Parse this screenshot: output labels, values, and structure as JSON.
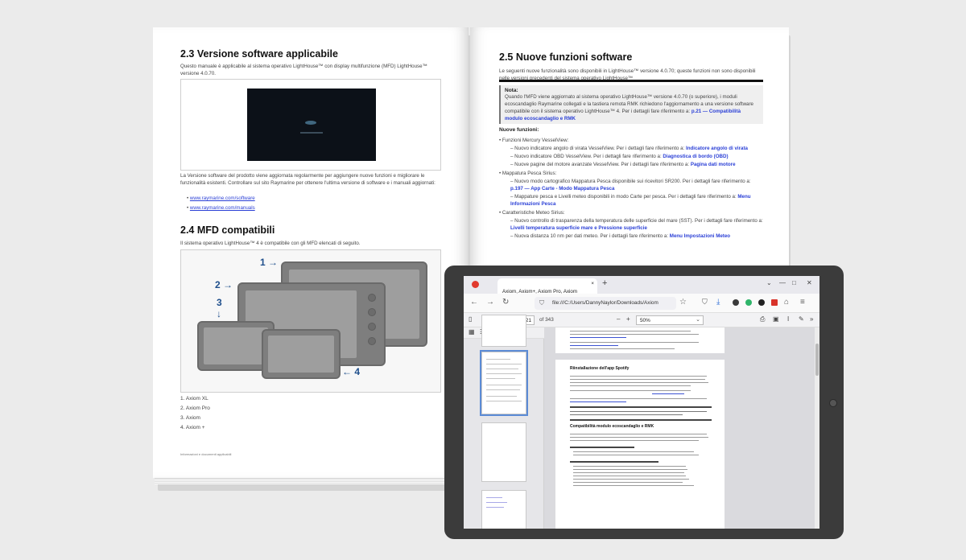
{
  "manual": {
    "left_page": {
      "section_23_title": "2.3 Versione software applicabile",
      "section_23_intro": "Questo manuale è applicabile al sistema operativo LightHouse™ con display multifunzione (MFD) LightHouse™ versione 4.0.70.",
      "section_23_body": "La Versione software del prodotto viene aggiornata regolarmente per aggiungere nuove funzioni e migliorare le funzionalità esistenti. Controllare sul sito Raymarine per ottenere l'ultima versione di software e i manuali aggiornati:",
      "links": [
        "www.raymarine.com/software",
        "www.raymarine.com/manuals"
      ],
      "section_24_title": "2.4 MFD compatibili",
      "section_24_intro": "Il sistema operativo LightHouse™ 4 è compatibile con gli MFD elencati di seguito.",
      "callouts": [
        "1",
        "2",
        "3",
        "4"
      ],
      "mfd_list": [
        "1.   Axiom XL",
        "2.   Axiom Pro",
        "3.   Axiom",
        "4.   Axiom +"
      ],
      "footer": "Informazioni e documenti applicabili"
    },
    "right_page": {
      "section_25_title": "2.5 Nuove funzioni software",
      "intro": "Le seguenti nuove funzionalità sono disponibili in LightHouse™ versione 4.0.70; queste funzioni non sono disponibili nelle versioni precedenti del sistema operativo LightHouse™",
      "note_title": "Nota:",
      "note_body": "Quando l'MFD viene aggiornato al sistema operativo LightHouse™ versione 4.0.70 (o superiore), i moduli ecoscandaglio Raymarine collegati e la tastiera remota RMK richiedono l'aggiornamento a una versione software compatibile con il sistema operativo LightHouse™ 4. Per i dettagli fare riferimento a:",
      "note_link": "p.21 — Compatibilità modulo ecoscandaglio e RMK",
      "new_features_title": "Nuove funzioni:",
      "features": [
        {
          "level": 1,
          "text": "Funzioni Mercury VesselView:"
        },
        {
          "level": 2,
          "text": "Nuovo indicatore angolo di virata VesselView. Per i dettagli fare riferimento a:",
          "link": "Indicatore angolo di virata"
        },
        {
          "level": 2,
          "text": "Nuovo indicatore OBD VesselView. Per i dettagli fare riferimento a:",
          "link": "Diagnostica di bordo (OBD)"
        },
        {
          "level": 2,
          "text": "Nuove pagine del motore avanzate VesselView. Per i dettagli fare riferimento a:",
          "link": "Pagina dati motore"
        },
        {
          "level": 1,
          "text": "Mappatura Pesca Sirius:"
        },
        {
          "level": 2,
          "text": "Nuovo modo cartografico Mappatura Pesca disponibile sui ricevitori SR200. Per i dettagli fare riferimento a:",
          "link": "p.197 — App Carte - Modo Mappatura Pesca"
        },
        {
          "level": 2,
          "text": "Mappature pesca e Livelli meteo disponibili in modo Carte per pesca. Per i dettagli fare riferimento a:",
          "link": "Menu Informazioni Pesca"
        },
        {
          "level": 1,
          "text": "Caratteristiche Meteo Sirius:"
        },
        {
          "level": 2,
          "text": "Nuovo controllo di trasparenza della temperatura delle superficie del mare (SST). Per i dettagli fare riferimento a:",
          "link": "Livelli temperatura superficie mare e Pressione superficie"
        },
        {
          "level": 2,
          "text": "Nuova distanza 10 nm per dati meteo. Per i dettagli fare riferimento a:",
          "link": "Menu Impostazioni Meteo"
        }
      ]
    }
  },
  "browser": {
    "tab_title": "Axiom, Axiom+, Axiom Pro, Axiom",
    "url": "file:///C:/Users/DannyNaylor/Downloads/Axiom",
    "page_number": "21",
    "page_total": "of 343",
    "zoom": "50%",
    "pdf_heading": "Riinstallazione dell'app Spotify",
    "pdf_heading2": "Compatibilità modulo ecoscandaglio e RMK"
  },
  "colors": {
    "link_blue": "#2a3fd6",
    "callout_blue": "#1f4f8c",
    "tablet_bezel": "#3b3b3b",
    "browser_red": "#e13a2e"
  },
  "icons": [
    "browser-logo-icon",
    "back-icon",
    "forward-icon",
    "reload-icon",
    "shield-icon",
    "bookmark-star-icon",
    "download-icon",
    "print-icon",
    "search-icon",
    "sidebar-toggle-icon"
  ]
}
